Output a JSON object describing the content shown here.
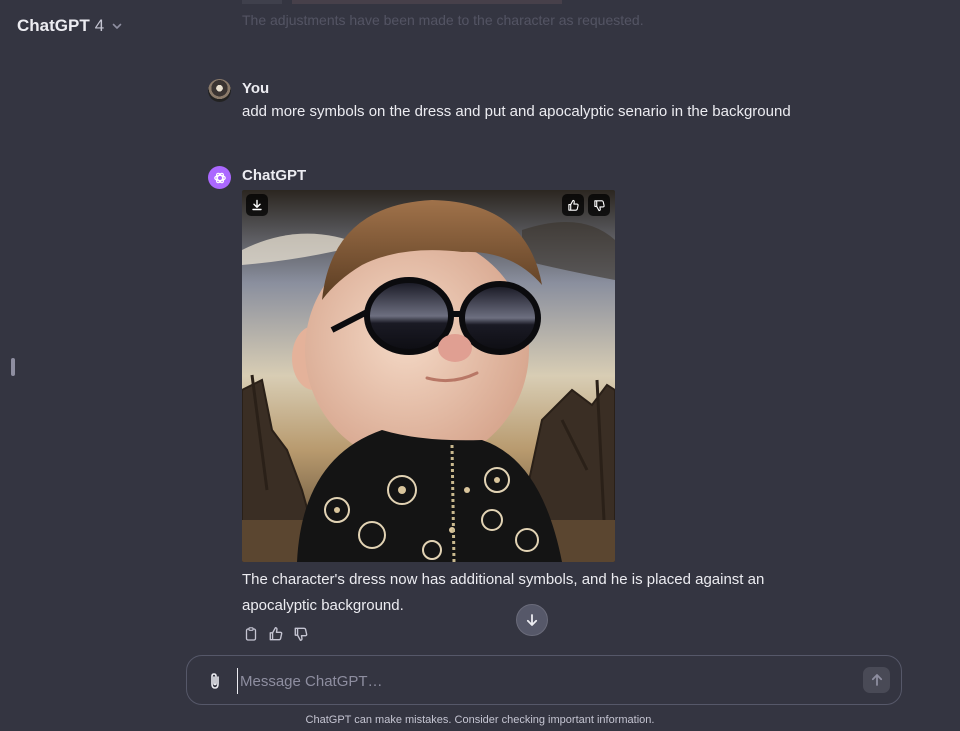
{
  "header": {
    "title": "ChatGPT",
    "version": "4"
  },
  "faded_previous": "The adjustments have been made to the character as requested.",
  "messages": [
    {
      "author": "You",
      "text": "add more symbols on the dress and put and apocalyptic senario in the background"
    },
    {
      "author": "ChatGPT",
      "response_line_1": "The character's dress now has additional symbols, and he is placed against an",
      "response_line_2": "apocalyptic background."
    }
  ],
  "icons": {
    "model_menu": "chevron-down-icon",
    "download": "download-icon",
    "image_like": "thumbs-up-icon",
    "image_dislike": "thumbs-down-icon",
    "copy": "clipboard-icon",
    "like": "thumbs-up-icon",
    "dislike": "thumbs-down-icon",
    "scroll_down": "arrow-down-icon",
    "attach": "paperclip-icon",
    "send": "arrow-up-icon"
  },
  "composer": {
    "placeholder": "Message ChatGPT…",
    "value": ""
  },
  "disclaimer": "ChatGPT can make mistakes. Consider checking important information.",
  "colors": {
    "background": "#343541",
    "gpt_avatar": "#ab68ff",
    "text": "#ececf1"
  }
}
